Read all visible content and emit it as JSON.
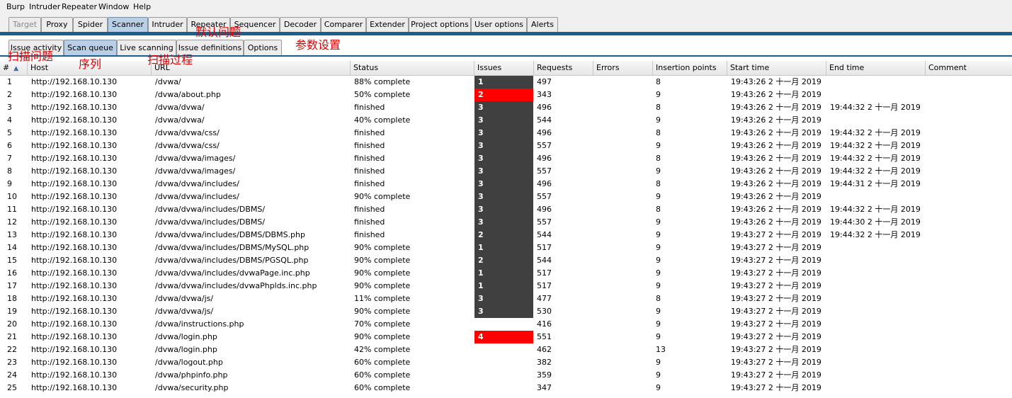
{
  "menu": [
    "Burp",
    "Intruder",
    "Repeater",
    "Window",
    "Help"
  ],
  "top_tabs": [
    "Target",
    "Proxy",
    "Spider",
    "Scanner",
    "Intruder",
    "Repeater",
    "Sequencer",
    "Decoder",
    "Comparer",
    "Extender",
    "Project options",
    "User options",
    "Alerts"
  ],
  "top_tabs_active": "Scanner",
  "top_tabs_disabled": "Target",
  "sub_tabs": [
    "Issue activity",
    "Scan queue",
    "Live scanning",
    "Issue definitions",
    "Options"
  ],
  "sub_tabs_active": "Scan queue",
  "annotations": {
    "scan_issues": "扫描问题",
    "queue": "序列",
    "scan_process": "扫描过程",
    "default_issues": "默认问题",
    "param_settings": "参数设置"
  },
  "colors": {
    "accent": "#1b5f8e",
    "active_tab": "#b8cfe5",
    "issue_dark": "#404040",
    "issue_red": "#ff0000",
    "annotation": "#e00000"
  },
  "columns": [
    "#",
    "Host",
    "URL",
    "Status",
    "Issues",
    "Requests",
    "Errors",
    "Insertion points",
    "Start time",
    "End time",
    "Comment"
  ],
  "rows": [
    {
      "n": "1",
      "host": "http://192.168.10.130",
      "url": "/dvwa/",
      "status": "88% complete",
      "issues": "1",
      "severity": "dark",
      "requests": "497",
      "errors": "",
      "ip": "8",
      "start": "19:43:26 2 十一月 2019",
      "end": "",
      "comment": ""
    },
    {
      "n": "2",
      "host": "http://192.168.10.130",
      "url": "/dvwa/about.php",
      "status": "50% complete",
      "issues": "2",
      "severity": "red",
      "requests": "343",
      "errors": "",
      "ip": "9",
      "start": "19:43:26 2 十一月 2019",
      "end": "",
      "comment": ""
    },
    {
      "n": "3",
      "host": "http://192.168.10.130",
      "url": "/dvwa/dvwa/",
      "status": "finished",
      "issues": "3",
      "severity": "dark",
      "requests": "496",
      "errors": "",
      "ip": "8",
      "start": "19:43:26 2 十一月 2019",
      "end": "19:44:32 2 十一月 2019",
      "comment": ""
    },
    {
      "n": "4",
      "host": "http://192.168.10.130",
      "url": "/dvwa/dvwa/",
      "status": "40% complete",
      "issues": "3",
      "severity": "dark",
      "requests": "544",
      "errors": "",
      "ip": "9",
      "start": "19:43:26 2 十一月 2019",
      "end": "",
      "comment": ""
    },
    {
      "n": "5",
      "host": "http://192.168.10.130",
      "url": "/dvwa/dvwa/css/",
      "status": "finished",
      "issues": "3",
      "severity": "dark",
      "requests": "496",
      "errors": "",
      "ip": "8",
      "start": "19:43:26 2 十一月 2019",
      "end": "19:44:32 2 十一月 2019",
      "comment": ""
    },
    {
      "n": "6",
      "host": "http://192.168.10.130",
      "url": "/dvwa/dvwa/css/",
      "status": "finished",
      "issues": "3",
      "severity": "dark",
      "requests": "557",
      "errors": "",
      "ip": "9",
      "start": "19:43:26 2 十一月 2019",
      "end": "19:44:32 2 十一月 2019",
      "comment": ""
    },
    {
      "n": "7",
      "host": "http://192.168.10.130",
      "url": "/dvwa/dvwa/images/",
      "status": "finished",
      "issues": "3",
      "severity": "dark",
      "requests": "496",
      "errors": "",
      "ip": "8",
      "start": "19:43:26 2 十一月 2019",
      "end": "19:44:32 2 十一月 2019",
      "comment": ""
    },
    {
      "n": "8",
      "host": "http://192.168.10.130",
      "url": "/dvwa/dvwa/images/",
      "status": "finished",
      "issues": "3",
      "severity": "dark",
      "requests": "557",
      "errors": "",
      "ip": "9",
      "start": "19:43:26 2 十一月 2019",
      "end": "19:44:32 2 十一月 2019",
      "comment": ""
    },
    {
      "n": "9",
      "host": "http://192.168.10.130",
      "url": "/dvwa/dvwa/includes/",
      "status": "finished",
      "issues": "3",
      "severity": "dark",
      "requests": "496",
      "errors": "",
      "ip": "8",
      "start": "19:43:26 2 十一月 2019",
      "end": "19:44:31 2 十一月 2019",
      "comment": ""
    },
    {
      "n": "10",
      "host": "http://192.168.10.130",
      "url": "/dvwa/dvwa/includes/",
      "status": "90% complete",
      "issues": "3",
      "severity": "dark",
      "requests": "557",
      "errors": "",
      "ip": "9",
      "start": "19:43:26 2 十一月 2019",
      "end": "",
      "comment": ""
    },
    {
      "n": "11",
      "host": "http://192.168.10.130",
      "url": "/dvwa/dvwa/includes/DBMS/",
      "status": "finished",
      "issues": "3",
      "severity": "dark",
      "requests": "496",
      "errors": "",
      "ip": "8",
      "start": "19:43:26 2 十一月 2019",
      "end": "19:44:32 2 十一月 2019",
      "comment": ""
    },
    {
      "n": "12",
      "host": "http://192.168.10.130",
      "url": "/dvwa/dvwa/includes/DBMS/",
      "status": "finished",
      "issues": "3",
      "severity": "dark",
      "requests": "557",
      "errors": "",
      "ip": "9",
      "start": "19:43:26 2 十一月 2019",
      "end": "19:44:30 2 十一月 2019",
      "comment": ""
    },
    {
      "n": "13",
      "host": "http://192.168.10.130",
      "url": "/dvwa/dvwa/includes/DBMS/DBMS.php",
      "status": "finished",
      "issues": "2",
      "severity": "dark",
      "requests": "544",
      "errors": "",
      "ip": "9",
      "start": "19:43:27 2 十一月 2019",
      "end": "19:44:32 2 十一月 2019",
      "comment": ""
    },
    {
      "n": "14",
      "host": "http://192.168.10.130",
      "url": "/dvwa/dvwa/includes/DBMS/MySQL.php",
      "status": "90% complete",
      "issues": "1",
      "severity": "dark",
      "requests": "517",
      "errors": "",
      "ip": "9",
      "start": "19:43:27 2 十一月 2019",
      "end": "",
      "comment": ""
    },
    {
      "n": "15",
      "host": "http://192.168.10.130",
      "url": "/dvwa/dvwa/includes/DBMS/PGSQL.php",
      "status": "90% complete",
      "issues": "2",
      "severity": "dark",
      "requests": "544",
      "errors": "",
      "ip": "9",
      "start": "19:43:27 2 十一月 2019",
      "end": "",
      "comment": ""
    },
    {
      "n": "16",
      "host": "http://192.168.10.130",
      "url": "/dvwa/dvwa/includes/dvwaPage.inc.php",
      "status": "90% complete",
      "issues": "1",
      "severity": "dark",
      "requests": "517",
      "errors": "",
      "ip": "9",
      "start": "19:43:27 2 十一月 2019",
      "end": "",
      "comment": ""
    },
    {
      "n": "17",
      "host": "http://192.168.10.130",
      "url": "/dvwa/dvwa/includes/dvwaPhplds.inc.php",
      "status": "90% complete",
      "issues": "1",
      "severity": "dark",
      "requests": "517",
      "errors": "",
      "ip": "9",
      "start": "19:43:27 2 十一月 2019",
      "end": "",
      "comment": ""
    },
    {
      "n": "18",
      "host": "http://192.168.10.130",
      "url": "/dvwa/dvwa/js/",
      "status": "11% complete",
      "issues": "3",
      "severity": "dark",
      "requests": "477",
      "errors": "",
      "ip": "8",
      "start": "19:43:27 2 十一月 2019",
      "end": "",
      "comment": ""
    },
    {
      "n": "19",
      "host": "http://192.168.10.130",
      "url": "/dvwa/dvwa/js/",
      "status": "90% complete",
      "issues": "3",
      "severity": "dark",
      "requests": "530",
      "errors": "",
      "ip": "9",
      "start": "19:43:27 2 十一月 2019",
      "end": "",
      "comment": ""
    },
    {
      "n": "20",
      "host": "http://192.168.10.130",
      "url": "/dvwa/instructions.php",
      "status": "70% complete",
      "issues": "",
      "severity": "none",
      "requests": "416",
      "errors": "",
      "ip": "9",
      "start": "19:43:27 2 十一月 2019",
      "end": "",
      "comment": ""
    },
    {
      "n": "21",
      "host": "http://192.168.10.130",
      "url": "/dvwa/login.php",
      "status": "90% complete",
      "issues": "4",
      "severity": "red",
      "requests": "551",
      "errors": "",
      "ip": "9",
      "start": "19:43:27 2 十一月 2019",
      "end": "",
      "comment": ""
    },
    {
      "n": "22",
      "host": "http://192.168.10.130",
      "url": "/dvwa/login.php",
      "status": "42% complete",
      "issues": "",
      "severity": "none",
      "requests": "462",
      "errors": "",
      "ip": "13",
      "start": "19:43:27 2 十一月 2019",
      "end": "",
      "comment": ""
    },
    {
      "n": "23",
      "host": "http://192.168.10.130",
      "url": "/dvwa/logout.php",
      "status": "60% complete",
      "issues": "",
      "severity": "none",
      "requests": "382",
      "errors": "",
      "ip": "9",
      "start": "19:43:27 2 十一月 2019",
      "end": "",
      "comment": ""
    },
    {
      "n": "24",
      "host": "http://192.168.10.130",
      "url": "/dvwa/phpinfo.php",
      "status": "60% complete",
      "issues": "",
      "severity": "none",
      "requests": "359",
      "errors": "",
      "ip": "9",
      "start": "19:43:27 2 十一月 2019",
      "end": "",
      "comment": ""
    },
    {
      "n": "25",
      "host": "http://192.168.10.130",
      "url": "/dvwa/security.php",
      "status": "60% complete",
      "issues": "",
      "severity": "none",
      "requests": "347",
      "errors": "",
      "ip": "9",
      "start": "19:43:27 2 十一月 2019",
      "end": "",
      "comment": ""
    }
  ]
}
